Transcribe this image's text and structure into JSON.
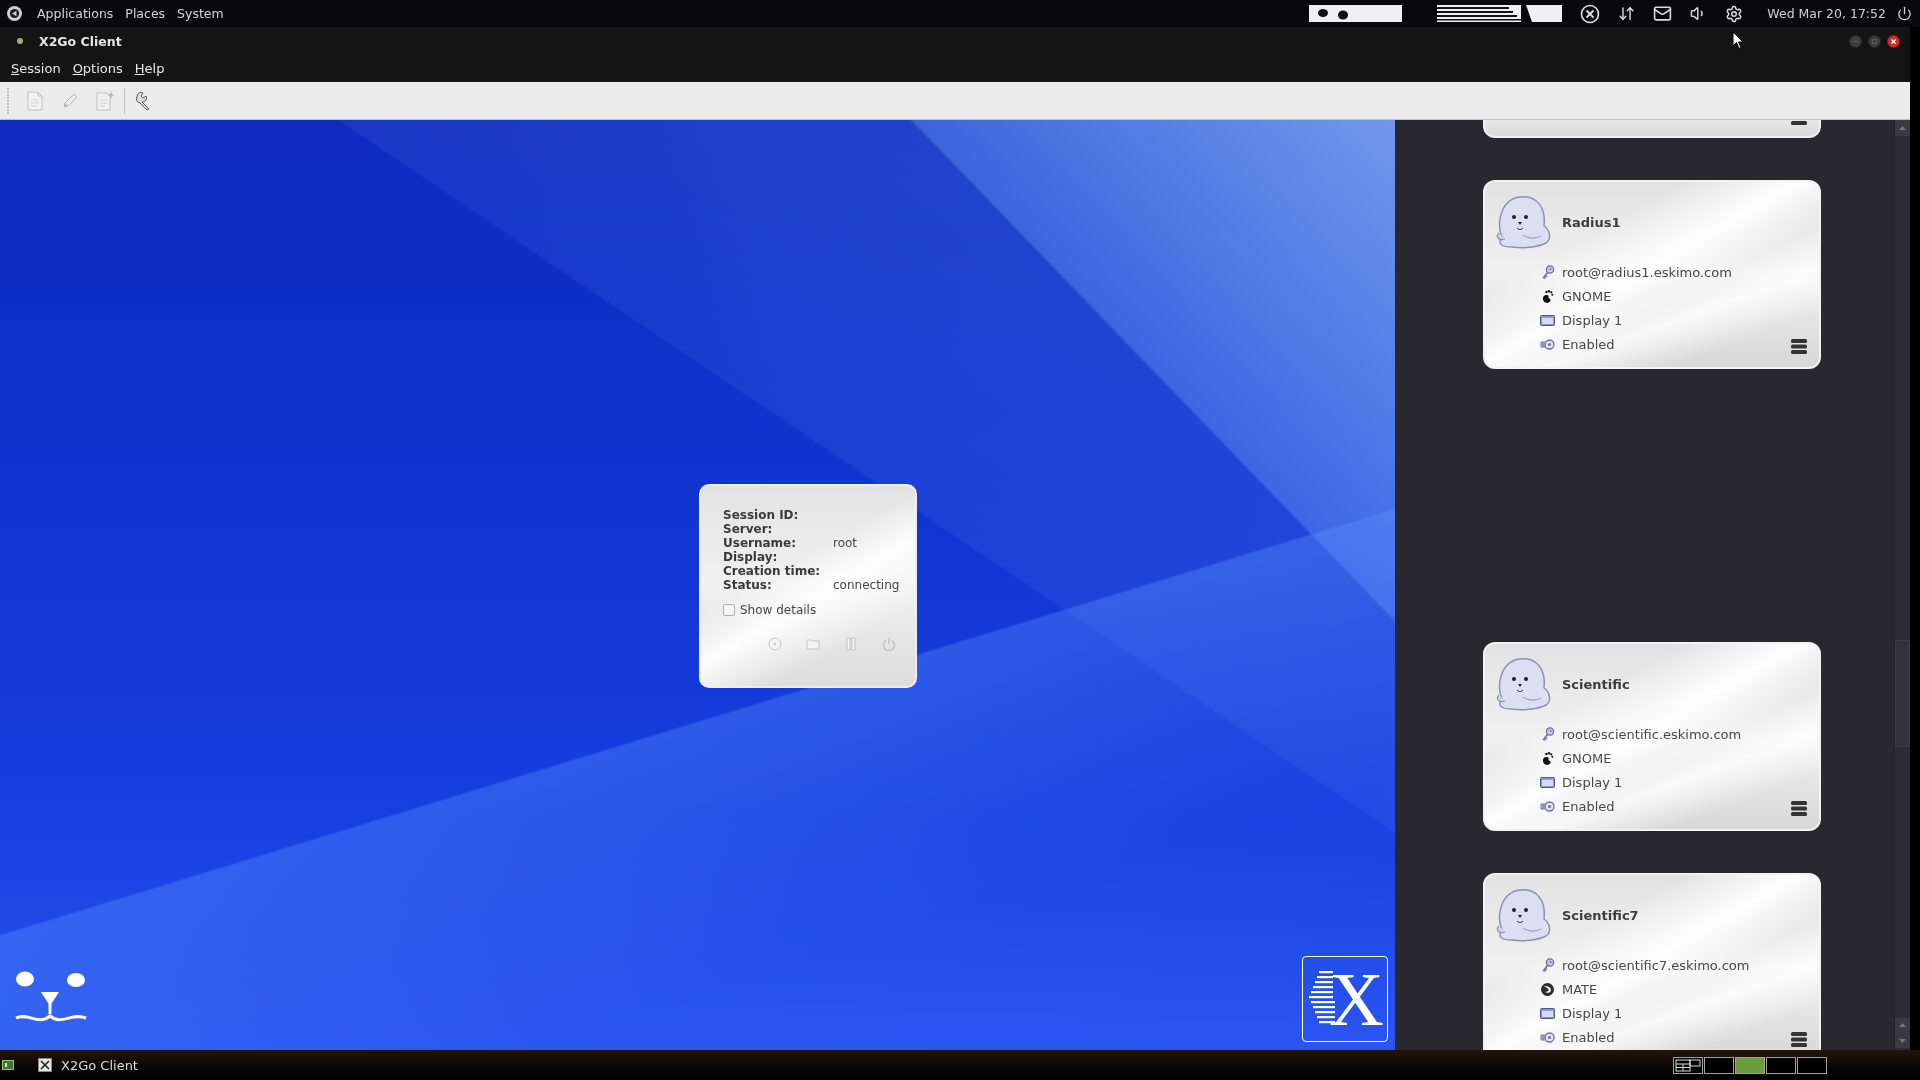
{
  "top_panel": {
    "menus": [
      "Applications",
      "Places",
      "System"
    ],
    "clock": "Wed Mar 20, 17:52"
  },
  "window": {
    "title": "X2Go Client"
  },
  "menu_bar": [
    "Session",
    "Options",
    "Help"
  ],
  "toolbar": [
    {
      "kind": "new",
      "disabled": true
    },
    {
      "kind": "edit",
      "disabled": true
    },
    {
      "kind": "export",
      "disabled": true
    },
    {
      "kind": "preferences",
      "disabled": false
    }
  ],
  "session_status": {
    "rows": [
      {
        "label": "Session ID:"
      },
      {
        "label": "Server:"
      },
      {
        "label": "Username:",
        "value": "root"
      },
      {
        "label": "Display:"
      },
      {
        "label": "Creation time:"
      },
      {
        "label": "Status:",
        "value": "connecting"
      }
    ],
    "show_details": {
      "label": "Show details",
      "checked": false
    },
    "actions": [
      {
        "kind": "disc",
        "disabled": true
      },
      {
        "kind": "folder",
        "disabled": true
      },
      {
        "kind": "pause",
        "disabled": true
      },
      {
        "kind": "power",
        "disabled": true
      }
    ]
  },
  "desktop": {
    "logo_letter": "X"
  },
  "sessions": [
    {
      "clipped": true
    },
    {
      "clipped": false,
      "name": "Radius1",
      "details": [
        {
          "kind": "server",
          "text": "root@radius1.eskimo.com"
        },
        {
          "kind": "gnome",
          "text": "GNOME"
        },
        {
          "kind": "display",
          "text": "Display 1"
        },
        {
          "kind": "sound",
          "text": "Enabled"
        }
      ]
    },
    {
      "clipped": false,
      "name": "Scientific",
      "details": [
        {
          "kind": "server",
          "text": "root@scientific.eskimo.com"
        },
        {
          "kind": "gnome",
          "text": "GNOME"
        },
        {
          "kind": "display",
          "text": "Display 1"
        },
        {
          "kind": "sound",
          "text": "Enabled"
        }
      ]
    },
    {
      "clipped": false,
      "name": "Scientific7",
      "details": [
        {
          "kind": "server",
          "text": "root@scientific7.eskimo.com"
        },
        {
          "kind": "mate",
          "text": "MATE"
        },
        {
          "kind": "display",
          "text": "Display 1"
        },
        {
          "kind": "sound",
          "text": "Enabled"
        }
      ]
    }
  ],
  "taskbar": {
    "tasks": [
      {
        "label": "X2Go Client",
        "selected": false
      }
    ],
    "workspaces": [
      {
        "selected": false,
        "has_windows": true
      },
      {
        "selected": false,
        "has_windows": false
      },
      {
        "selected": true,
        "has_windows": false
      },
      {
        "selected": false,
        "has_windows": false
      },
      {
        "selected": false,
        "has_windows": false
      }
    ]
  }
}
